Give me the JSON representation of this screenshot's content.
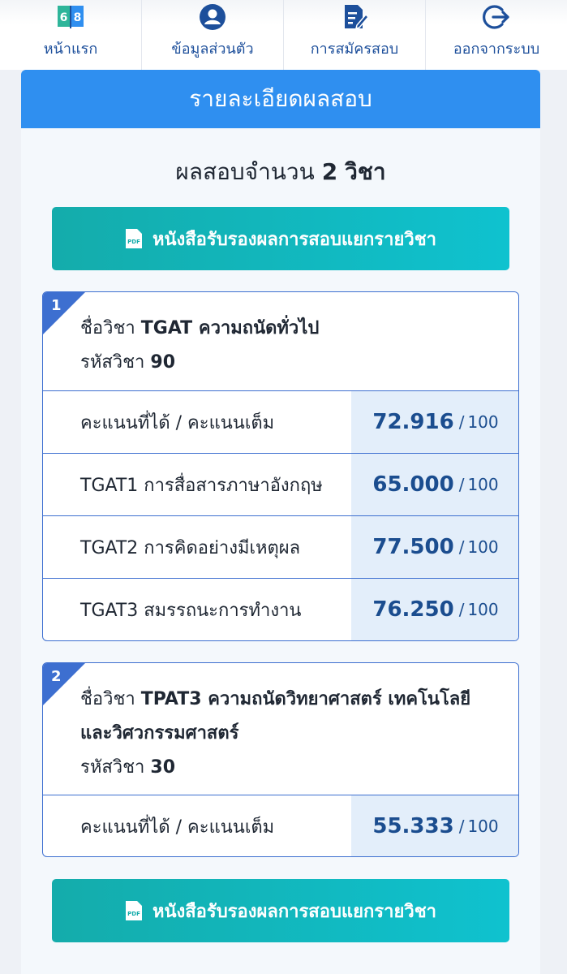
{
  "nav": {
    "items": [
      {
        "label": "หน้าแรก",
        "icon": "home-book-icon"
      },
      {
        "label": "ข้อมูลส่วนตัว",
        "icon": "user-profile-icon"
      },
      {
        "label": "การสมัครสอบ",
        "icon": "document-edit-icon"
      },
      {
        "label": "ออกจากระบบ",
        "icon": "logout-icon"
      }
    ],
    "home_icon_digits": [
      "6",
      "8"
    ]
  },
  "panel": {
    "title": "รายละเอียดผลสอบ",
    "count_prefix": "ผลสอบจำนวน",
    "count": "2",
    "count_suffix": "วิชา",
    "cert_button_label": "หนังสือรับรองผลการสอบแยกรายวิชา",
    "pdf_icon_text": "PDF"
  },
  "subjects": [
    {
      "number": "1",
      "name_prefix": "ชื่อวิชา",
      "name": "TGAT ความถนัดทั่วไป",
      "name_line2": "",
      "code_prefix": "รหัสวิชา",
      "code": "90",
      "rows": [
        {
          "label": "คะแนนที่ได้ / คะแนนเต็ม",
          "score": "72.916",
          "full": "100"
        },
        {
          "label": "TGAT1 การสื่อสารภาษาอังกฤษ",
          "score": "65.000",
          "full": "100"
        },
        {
          "label": "TGAT2 การคิดอย่างมีเหตุผล",
          "score": "77.500",
          "full": "100"
        },
        {
          "label": "TGAT3 สมรรถนะการทำงาน",
          "score": "76.250",
          "full": "100"
        }
      ]
    },
    {
      "number": "2",
      "name_prefix": "ชื่อวิชา",
      "name": "TPAT3 ความถนัดวิทยาศาสตร์ เทคโนโลยี",
      "name_line2": "และวิศวกรรมศาสตร์",
      "code_prefix": "รหัสวิชา",
      "code": "30",
      "rows": [
        {
          "label": "คะแนนที่ได้ / คะแนนเต็ม",
          "score": "55.333",
          "full": "100"
        }
      ]
    }
  ],
  "colors": {
    "header_blue": "#2f8ff0",
    "card_border": "#3d6fd0",
    "button_teal_start": "#14acab",
    "button_teal_end": "#0fc2cf",
    "score_text": "#1b4d8f",
    "nav_text": "#1d4f9b"
  }
}
